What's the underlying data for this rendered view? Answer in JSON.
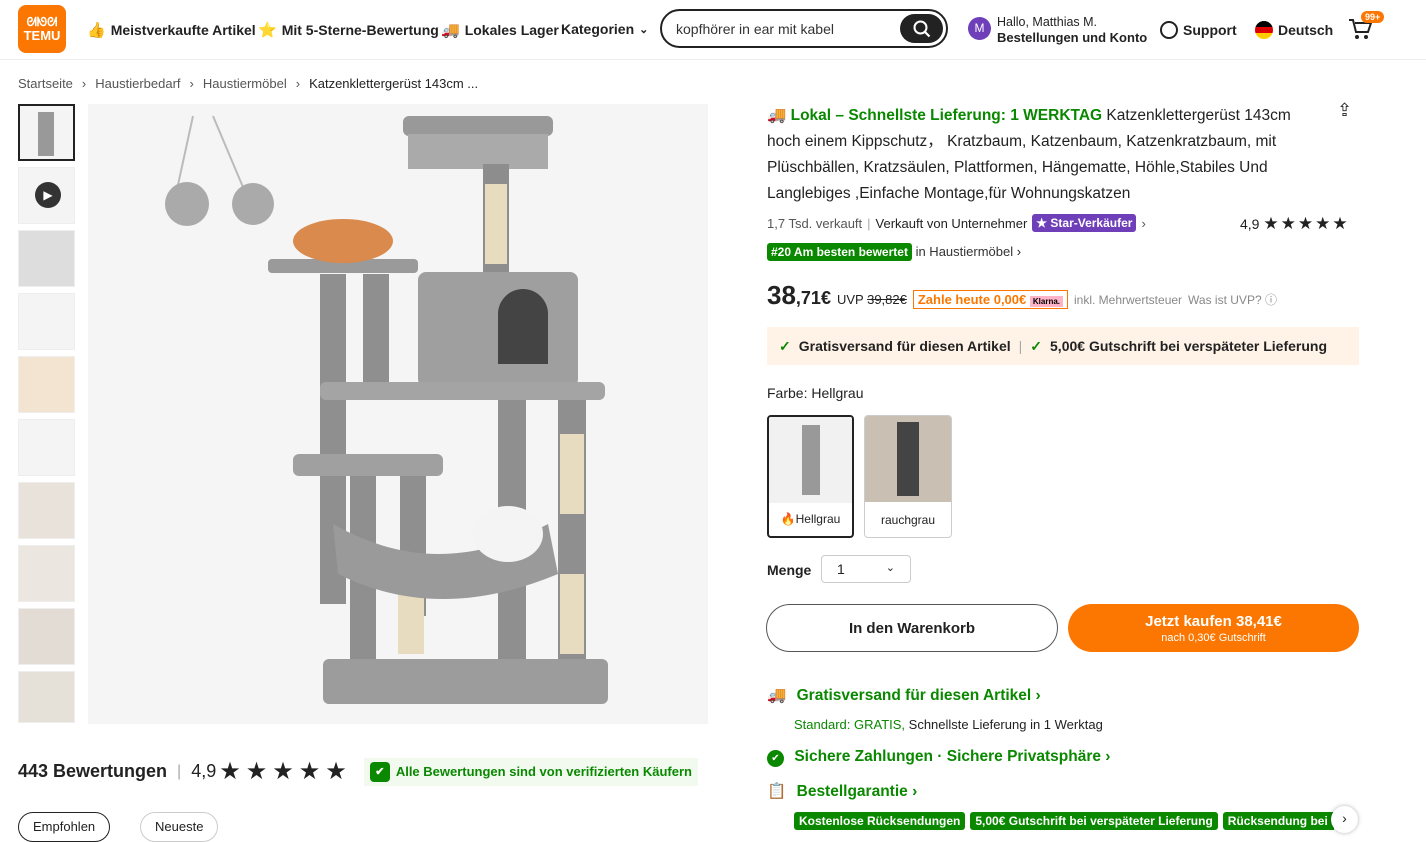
{
  "header": {
    "logo_top": "ᘛᘚᘛ",
    "logo_text": "TEMU",
    "nav": [
      "Meistverkaufte Artikel",
      "Mit 5-Sterne-Bewertung",
      "Lokales Lager",
      "Kategorien"
    ],
    "search_value": "kopfhörer in ear mit kabel",
    "avatar_letter": "M",
    "greeting": "Hallo, Matthias M.",
    "account": "Bestellungen und Konto",
    "support": "Support",
    "language": "Deutsch",
    "cart_badge": "99+"
  },
  "breadcrumb": [
    "Startseite",
    "Haustierbedarf",
    "Haustiermöbel",
    "Katzenklettergerüst 143cm ..."
  ],
  "product": {
    "delivery_label": "Lokal – Schnellste Lieferung: 1 WERKTAG",
    "title": "Katzenklettergerüst 143cm hoch einem Kippschutz， Kratzbaum, Katzenbaum, Katzenkratzbaum, mit Plüschbällen, Kratzsäulen, Plattformen, Hängematte, Höhle,Stabiles Und Langlebiges ,Einfache Montage,für Wohnungskatzen",
    "sold": "1,7 Tsd. verkauft",
    "seller": "Verkauft von Unternehmer",
    "star_seller": "Star-Verkäufer",
    "rating": "4,9",
    "rank_badge": "#20 Am besten bewertet",
    "rank_category": "in Haustiermöbel",
    "price_main": "38",
    "price_cents": ",71€",
    "uvp_label": "UVP",
    "uvp": "39,82€",
    "pay_today": "Zahle heute 0,00€",
    "klarna": "Klarna.",
    "vat": "inkl. Mehrwertsteuer",
    "uvp_q": "Was ist UVP?",
    "benefit1": "Gratisversand für diesen Artikel",
    "benefit2": "5,00€ Gutschrift bei verspäteter Lieferung",
    "color_label": "Farbe: Hellgrau",
    "colors": [
      "Hellgrau",
      "rauchgrau"
    ],
    "qty_label": "Menge",
    "qty_value": "1",
    "add_cart": "In den Warenkorb",
    "buy_now": "Jetzt kaufen 38,41€",
    "buy_sub": "nach 0,30€ Gutschrift"
  },
  "info": {
    "shipping_title": "Gratisversand für diesen Artikel",
    "shipping_std": "Standard: GRATIS,",
    "shipping_fast": "Schnellste Lieferung in 1 Werktag",
    "secure": "Sichere Zahlungen · Sichere Privatsphäre",
    "guarantee": "Bestellgarantie",
    "tags": [
      "Kostenlose Rücksendungen",
      "5,00€ Gutschrift bei verspäteter Lieferung",
      "Rücksendung bei Beschädigung"
    ]
  },
  "reviews": {
    "count": "443 Bewertungen",
    "rating": "4,9",
    "verified": "Alle Bewertungen sind von verifizierten Käufern",
    "filters": [
      "Empfohlen",
      "Neueste"
    ]
  },
  "colors": {
    "accent": "#fb7701",
    "green": "#0a8800",
    "purple": "#6e3fb8",
    "dark": "#222222"
  }
}
